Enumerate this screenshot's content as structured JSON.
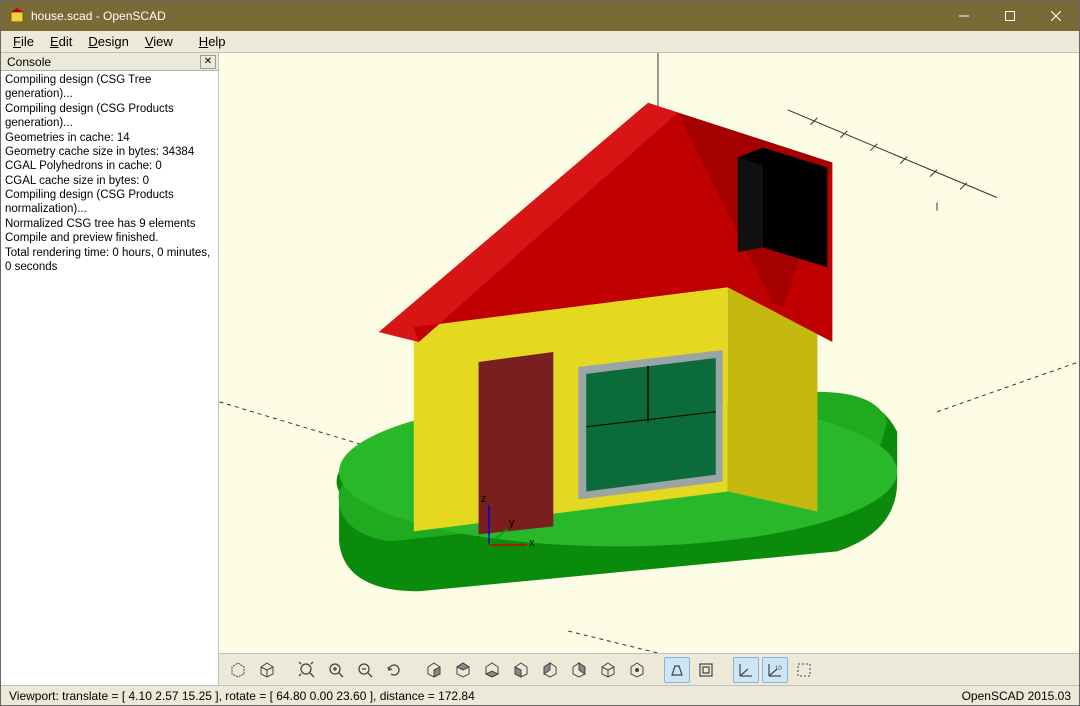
{
  "window": {
    "title": "house.scad - OpenSCAD"
  },
  "menu": {
    "file": "File",
    "edit": "Edit",
    "design": "Design",
    "view": "View",
    "help": "Help"
  },
  "console": {
    "title": "Console",
    "text": "Compiling design (CSG Tree generation)...\nCompiling design (CSG Products generation)...\nGeometries in cache: 14\nGeometry cache size in bytes: 34384\nCGAL Polyhedrons in cache: 0\nCGAL cache size in bytes: 0\nCompiling design (CSG Products normalization)...\nNormalized CSG tree has 9 elements\nCompile and preview finished.\nTotal rendering time: 0 hours, 0 minutes, 0 seconds"
  },
  "axis": {
    "x": "x",
    "y": "y",
    "z": "z"
  },
  "status": {
    "left": "Viewport: translate = [ 4.10 2.57 15.25 ], rotate = [ 64.80 0.00 23.60 ], distance = 172.84",
    "right": "OpenSCAD 2015.03"
  },
  "toolbar": {
    "preview": "Preview",
    "render": "Render",
    "view_all": "View All",
    "zoom_in": "Zoom In",
    "zoom_out": "Zoom Out",
    "reset_view": "Reset View",
    "right": "Right",
    "top": "Top",
    "bottom": "Bottom",
    "left": "Left",
    "front": "Front",
    "back": "Back",
    "diagonal": "Diagonal",
    "center": "Center",
    "perspective": "Perspective",
    "orthogonal": "Orthogonal",
    "axes": "Show Axes",
    "scale_markers": "Show Scale Markers",
    "crosshairs": "Show Crosshairs"
  }
}
